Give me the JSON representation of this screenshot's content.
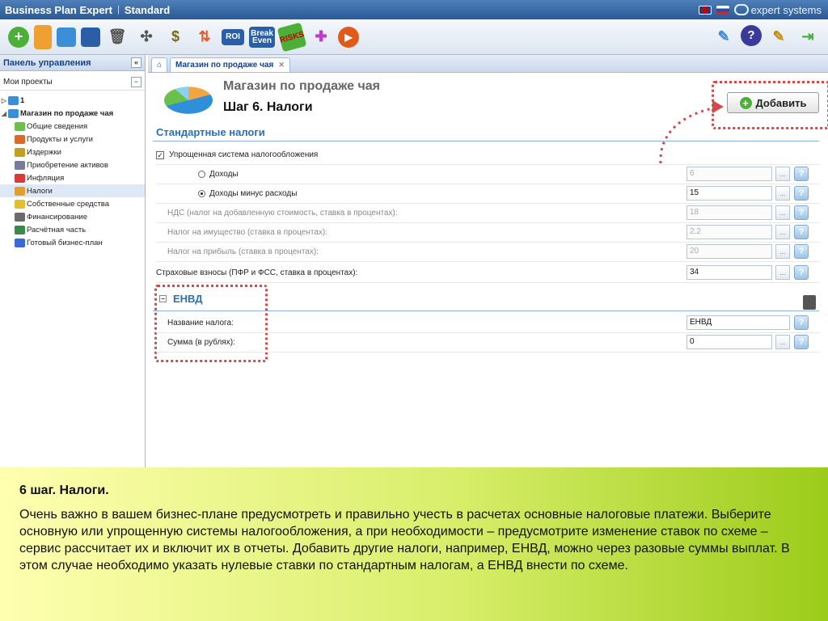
{
  "titlebar": {
    "app_name": "Business Plan Expert",
    "separator": "|",
    "edition": "Standard",
    "brand": "expert systems"
  },
  "toolbar": {
    "left_icons": [
      "add-icon",
      "folder-icon",
      "copy-icon",
      "save-icon",
      "delete-icon",
      "compass-icon",
      "money-bag-icon",
      "arrows-icon"
    ],
    "roi_label": "ROI",
    "break_even_label": "Break Even",
    "risks_label": "RISKS",
    "extra_icons": [
      "puzzle-icon",
      "play-icon"
    ],
    "right_icons": [
      "settings-user-icon",
      "help-icon",
      "edit-icon",
      "exit-icon"
    ]
  },
  "sidebar": {
    "header": "Панель управления",
    "collapse_glyph": "«",
    "sub_header": "Мои проекты",
    "sub_collapse_glyph": "−",
    "tree": [
      {
        "label": "1",
        "level": 0,
        "toggle": "▷"
      },
      {
        "label": "Магазин по продаже чая",
        "level": 0,
        "toggle": "◢",
        "bold": true
      },
      {
        "label": "Общие сведения",
        "level": 1
      },
      {
        "label": "Продукты и услуги",
        "level": 1
      },
      {
        "label": "Издержки",
        "level": 1
      },
      {
        "label": "Приобретение активов",
        "level": 1
      },
      {
        "label": "Инфляция",
        "level": 1
      },
      {
        "label": "Налоги",
        "level": 1,
        "selected": true
      },
      {
        "label": "Собственные средства",
        "level": 1
      },
      {
        "label": "Финансирование",
        "level": 1
      },
      {
        "label": "Расчётная часть",
        "level": 1
      },
      {
        "label": "Готовый бизнес-план",
        "level": 1
      }
    ]
  },
  "tabs": {
    "home_glyph": "⌂",
    "active_tab": "Магазин по продаже чая",
    "close_glyph": "✕"
  },
  "main": {
    "project_title": "Магазин по продаже чая",
    "step_title": "Шаг 6. Налоги",
    "add_button": "Добавить",
    "standard_section": "Стандартные налоги",
    "simplified_label": "Упрощенная система налогообложения",
    "income_label": "Доходы",
    "income_value": "6",
    "income_minus_label": "Доходы минус расходы",
    "income_minus_value": "15",
    "vat_label": "НДС (налог на добавленную стоимость, ставка в процентах):",
    "vat_value": "18",
    "property_label": "Налог на имущество (ставка в процентах):",
    "property_value": "2.2",
    "profit_label": "Налог на прибыль (ставка в процентах):",
    "profit_value": "20",
    "insurance_label": "Страховые взносы (ПФР и ФСС, ставка в процентах):",
    "insurance_value": "34",
    "envd_section": "ЕНВД",
    "tax_name_label": "Название налога:",
    "tax_name_value": "ЕНВД",
    "amount_label": "Сумма (в рублях):",
    "amount_value": "0",
    "dots_glyph": "...",
    "help_glyph": "?"
  },
  "overlay": {
    "title": "6 шаг. Налоги.",
    "text": "Очень важно в вашем бизнес-плане предусмотреть и правильно учесть в расчетах основные налоговые платежи. Выберите основную или упрощенную системы налогообложения, а при необходимости – предусмотрите изменение ставок по схеме – сервис рассчитает их и включит их в отчеты. Добавить другие налоги, например, ЕНВД, можно через разовые суммы выплат. В этом случае необходимо указать нулевые ставки по стандартным налогам, а ЕНВД внести по схеме."
  }
}
